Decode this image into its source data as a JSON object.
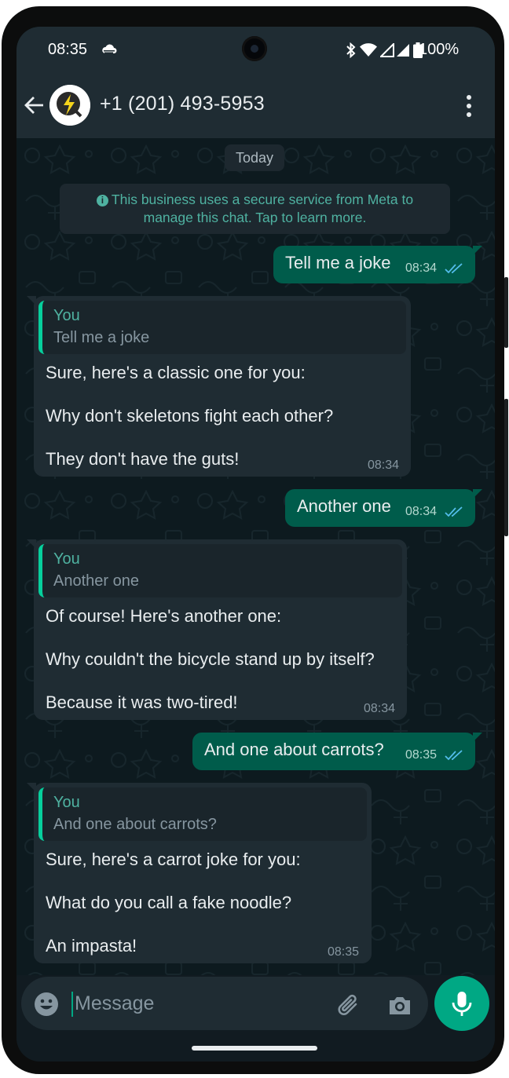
{
  "status_bar": {
    "time": "08:35",
    "battery": "100%"
  },
  "app_bar": {
    "contact": "+1 (201) 493-5953"
  },
  "chat": {
    "date": "Today",
    "secure_notice_line1": "This business uses a secure service from Meta to",
    "secure_notice_line2": "manage this chat. Tap to learn more.",
    "messages": [
      {
        "text": "Tell me a joke",
        "time": "08:34"
      },
      {
        "quote_author": "You",
        "quote_text": "Tell me a joke",
        "lines": [
          "Sure, here's a classic one for you:",
          "Why don't skeletons fight each other?",
          "They don't have the guts!"
        ],
        "time": "08:34"
      },
      {
        "text": "Another one",
        "time": "08:34"
      },
      {
        "quote_author": "You",
        "quote_text": "Another one",
        "lines": [
          "Of course! Here's another one:",
          "Why couldn't the bicycle stand up by itself?",
          "Because it was two-tired!"
        ],
        "time": "08:34"
      },
      {
        "text": "And one about carrots?",
        "time": "08:35"
      },
      {
        "quote_author": "You",
        "quote_text": "And one about carrots?",
        "lines": [
          "Sure, here's a carrot joke for you:",
          "What do you call a fake noodle?",
          "An impasta!"
        ],
        "time": "08:35"
      }
    ]
  },
  "composer": {
    "placeholder": "Message"
  },
  "icons": {
    "status": [
      "cloud-icon",
      "bluetooth-icon",
      "wifi-icon",
      "signal-icon",
      "battery-icon"
    ],
    "app_bar": [
      "back-arrow-icon",
      "more-vert-icon"
    ],
    "composer": [
      "emoji-icon",
      "attach-icon",
      "camera-icon",
      "mic-icon"
    ]
  },
  "colors": {
    "header": "#1f2c33",
    "chat_background": "#0d1a1f",
    "outgoing_bubble": "#005c4b",
    "incoming_bubble": "#1f2c33",
    "accent": "#00a884",
    "read_ticks": "#53bdeb"
  }
}
